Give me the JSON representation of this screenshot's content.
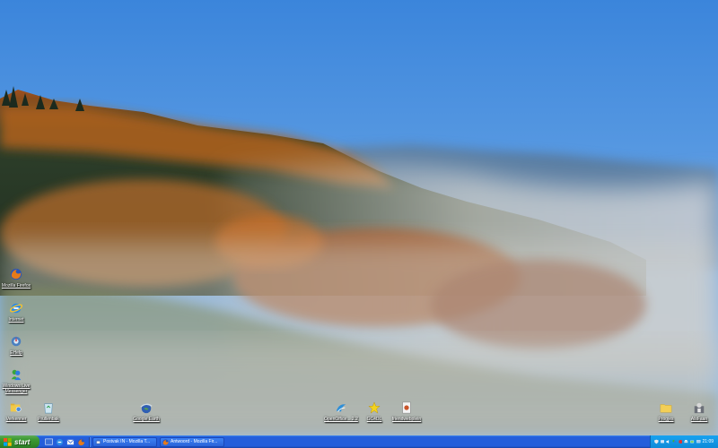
{
  "desktop": {
    "icons": [
      {
        "id": "firefox",
        "label": "Mozilla Firefox",
        "icon": "firefox-icon"
      },
      {
        "id": "internet",
        "label": "Internet",
        "icon": "internet-explorer-icon"
      },
      {
        "id": "ehelp",
        "label": "EHelp",
        "icon": "ehelp-icon"
      },
      {
        "id": "messenger",
        "label": "Windows Live Messenger",
        "icon": "messenger-icon"
      },
      {
        "id": "verkenner",
        "label": "Verkenner",
        "icon": "explorer-icon"
      },
      {
        "id": "prullenbak",
        "label": "Prullenbak",
        "icon": "recycle-bin-icon"
      },
      {
        "id": "googleearth",
        "label": "Google Earth",
        "icon": "google-earth-icon"
      },
      {
        "id": "openoffice",
        "label": "OpenOffice... 2.2",
        "icon": "openoffice-icon"
      },
      {
        "id": "gc4dl",
        "label": "GC4DL",
        "icon": "star-icon"
      },
      {
        "id": "friendwebplein",
        "label": "friendwebplein",
        "icon": "document-icon"
      },
      {
        "id": "progjes",
        "label": "Progjes",
        "icon": "folder-icon"
      },
      {
        "id": "alsfaan",
        "label": "AlsFaan",
        "icon": "user-icon"
      }
    ]
  },
  "taskbar": {
    "start_label": "start",
    "quick_launch": [
      "desktop-icon",
      "ie-icon",
      "outlook-icon",
      "firefox-icon"
    ],
    "tasks": [
      {
        "label": "Postvak IN - Mozilla T...",
        "icon": "thunderbird-icon"
      },
      {
        "label": "Antwoord - Mozilla Fir...",
        "icon": "firefox-icon"
      }
    ],
    "tray_icons": [
      "shield-icon",
      "network-icon",
      "volume-icon",
      "msn-icon",
      "security-icon",
      "printer-icon",
      "battery-icon",
      "display-icon"
    ],
    "clock": "21:09"
  },
  "colors": {
    "sky": "#4a8fe0",
    "taskbar": "#245edb",
    "start": "#3c9a35",
    "tray": "#0f8ad8"
  }
}
